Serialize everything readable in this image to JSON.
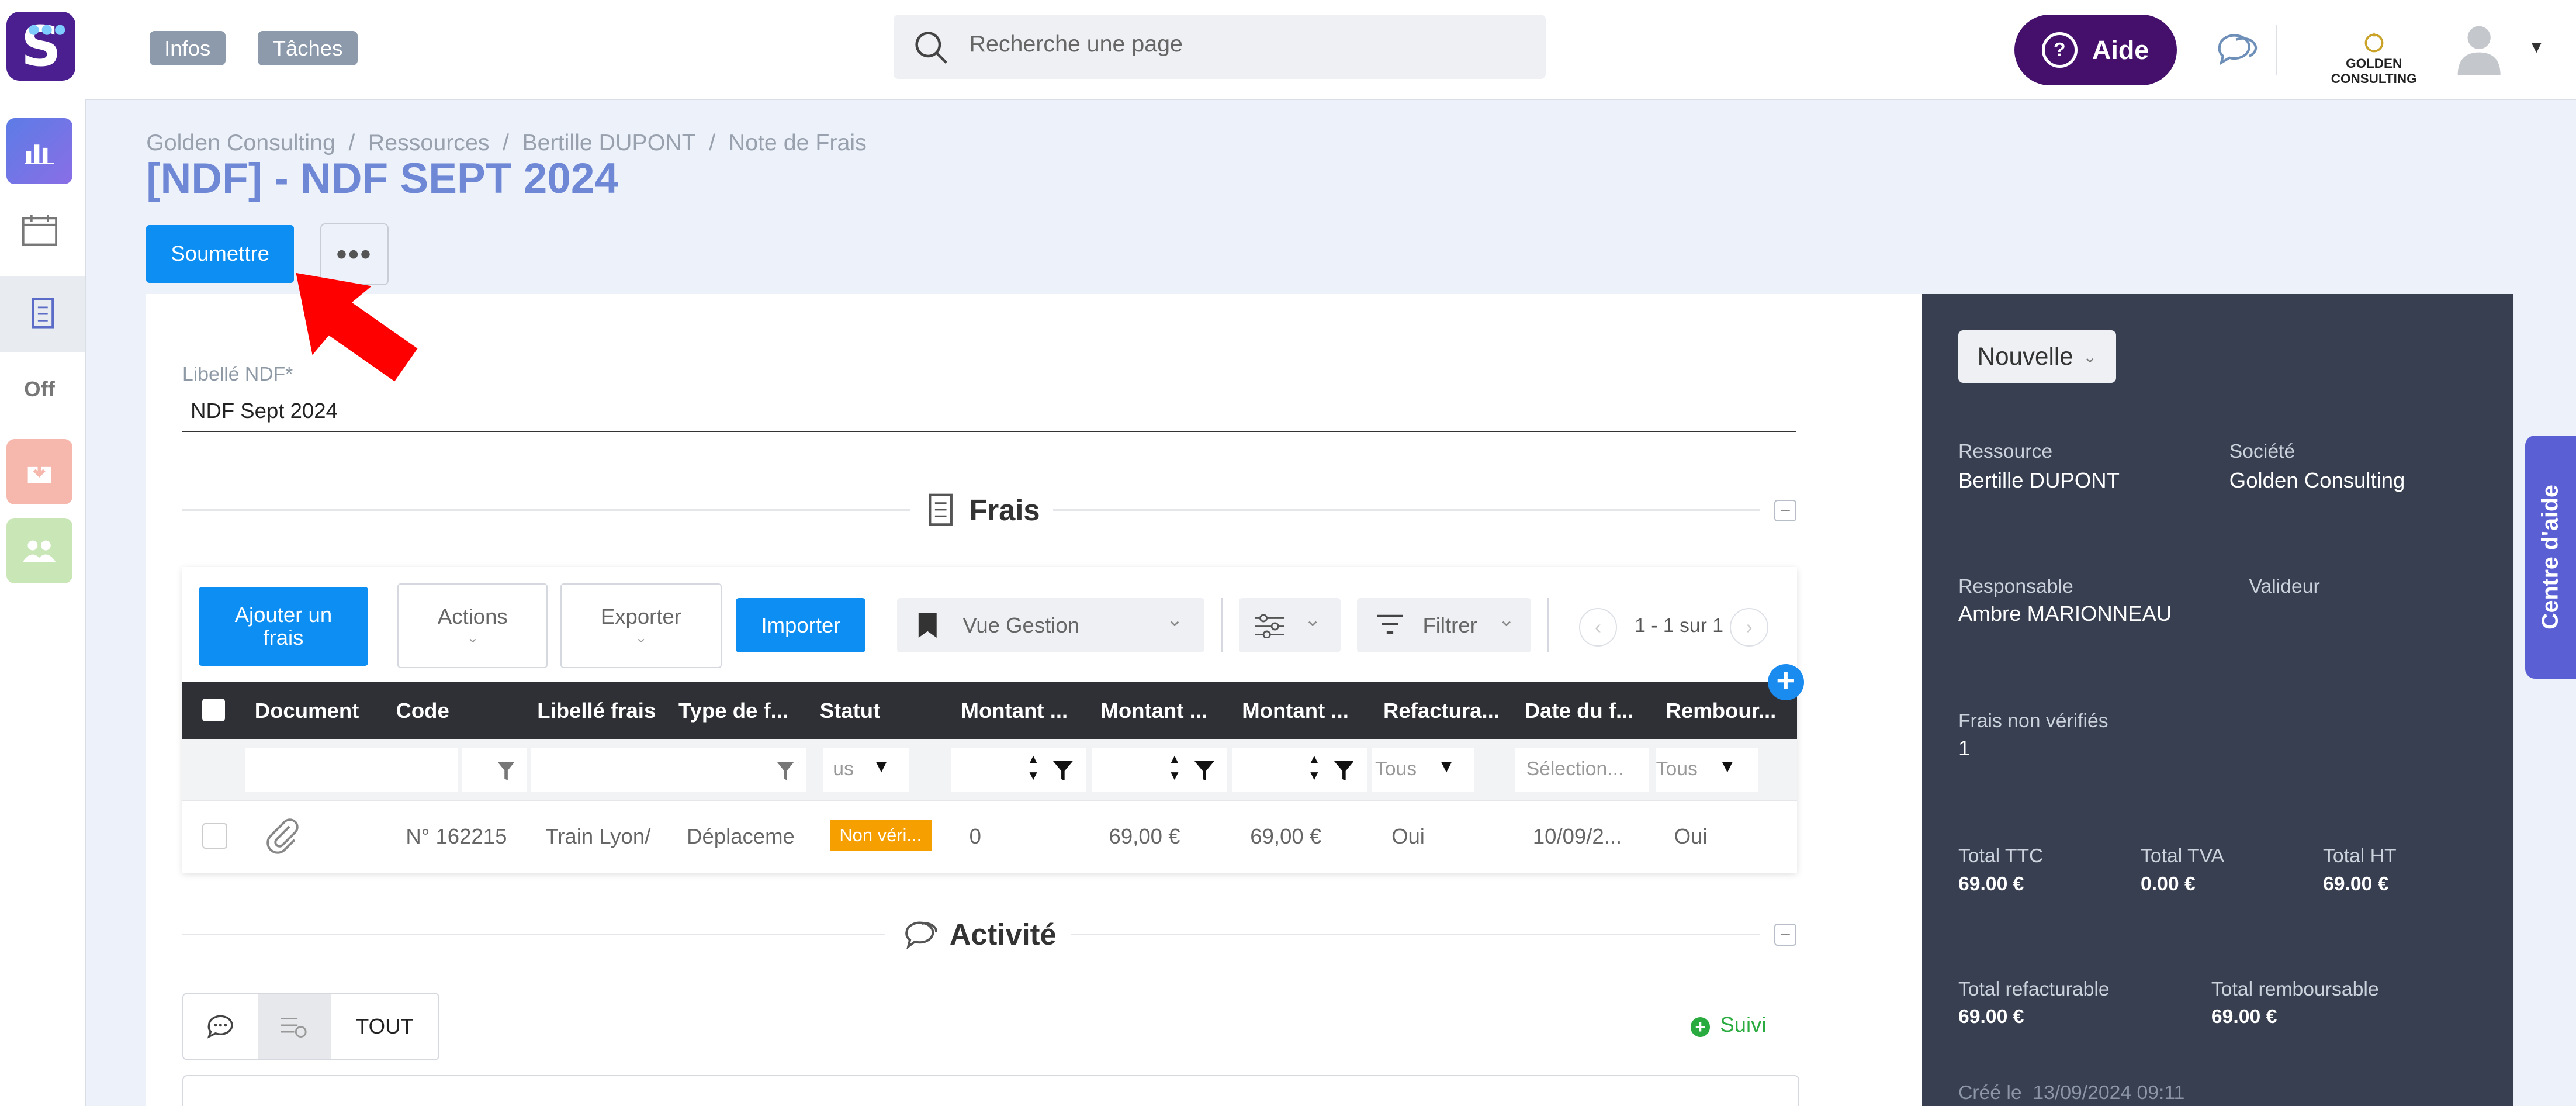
{
  "header": {
    "logo_letter": "S",
    "chips": [
      "Infos",
      "Tâches"
    ],
    "search_placeholder": "Recherche une page",
    "help_label": "Aide",
    "company_logo_text": "GOLDEN CONSULTING"
  },
  "sidebar": {
    "items": [
      {
        "icon": "chart-icon",
        "color": "#6f7fe0",
        "active": true
      },
      {
        "icon": "calendar-icon",
        "color": "#ffffff"
      },
      {
        "icon": "expense-report-icon",
        "color": "#e8ebf0"
      },
      {
        "icon": "off-icon",
        "color": "#ffffff",
        "text": "Off"
      },
      {
        "icon": "download-icon",
        "color": "#f6b7ad"
      },
      {
        "icon": "team-icon",
        "color": "#c9e6b6"
      }
    ]
  },
  "breadcrumb": [
    "Golden Consulting",
    "Ressources",
    "Bertille DUPONT",
    "Note de Frais"
  ],
  "page_title": "[NDF] - NDF SEPT 2024",
  "actions": {
    "submit_label": "Soumettre",
    "more_label": "•••"
  },
  "form": {
    "label_field_label": "Libellé NDF*",
    "label_field_value": "NDF Sept 2024"
  },
  "frais": {
    "section_title": "Frais",
    "toolbar": {
      "add_label": "Ajouter un frais",
      "actions_label": "Actions",
      "export_label": "Exporter",
      "import_label": "Importer",
      "view_label": "Vue Gestion",
      "filter_label": "Filtrer",
      "pagination": "1 - 1 sur 1"
    },
    "columns": [
      "Document",
      "Code",
      "Libellé frais",
      "Type de f...",
      "Statut",
      "Montant ...",
      "Montant ...",
      "Montant ...",
      "Refactura...",
      "Date du f...",
      "Rembour..."
    ],
    "filters": {
      "status": "us",
      "refacturable": "Tous",
      "date": "Sélection...",
      "remboursable": "Tous"
    },
    "rows": [
      {
        "code": "N° 162215",
        "libelle": "Train Lyon/",
        "type": "Déplaceme",
        "statut": "Non véri...",
        "montant1": "0",
        "montant2": "69,00 €",
        "montant3": "69,00 €",
        "refacturable": "Oui",
        "date": "10/09/2...",
        "remboursable": "Oui"
      }
    ]
  },
  "activity": {
    "section_title": "Activité",
    "tab_all": "TOUT",
    "follow_label": "Suivi"
  },
  "panel": {
    "status_label": "Nouvelle",
    "resource_label": "Ressource",
    "resource_value": "Bertille DUPONT",
    "company_label": "Société",
    "company_value": "Golden Consulting",
    "manager_label": "Responsable",
    "manager_value": "Ambre MARIONNEAU",
    "validator_label": "Valideur",
    "unverified_label": "Frais non vérifiés",
    "unverified_value": "1",
    "total_ttc_label": "Total TTC",
    "total_ttc_value": "69.00 €",
    "total_tva_label": "Total TVA",
    "total_tva_value": "0.00 €",
    "total_ht_label": "Total HT",
    "total_ht_value": "69.00 €",
    "refacturable_label": "Total refacturable",
    "refacturable_value": "69.00 €",
    "remboursable_label": "Total remboursable",
    "remboursable_value": "69.00 €",
    "created_text": "Créé le  13/09/2024 09:11"
  },
  "help_center_label": "Centre d'aide",
  "colors": {
    "accent": "#0d8ef2",
    "brand": "#44106b",
    "title": "#6f88d6",
    "panel": "#373f51",
    "status_badge": "#f59f00",
    "annotation_arrow": "#ff0000"
  }
}
